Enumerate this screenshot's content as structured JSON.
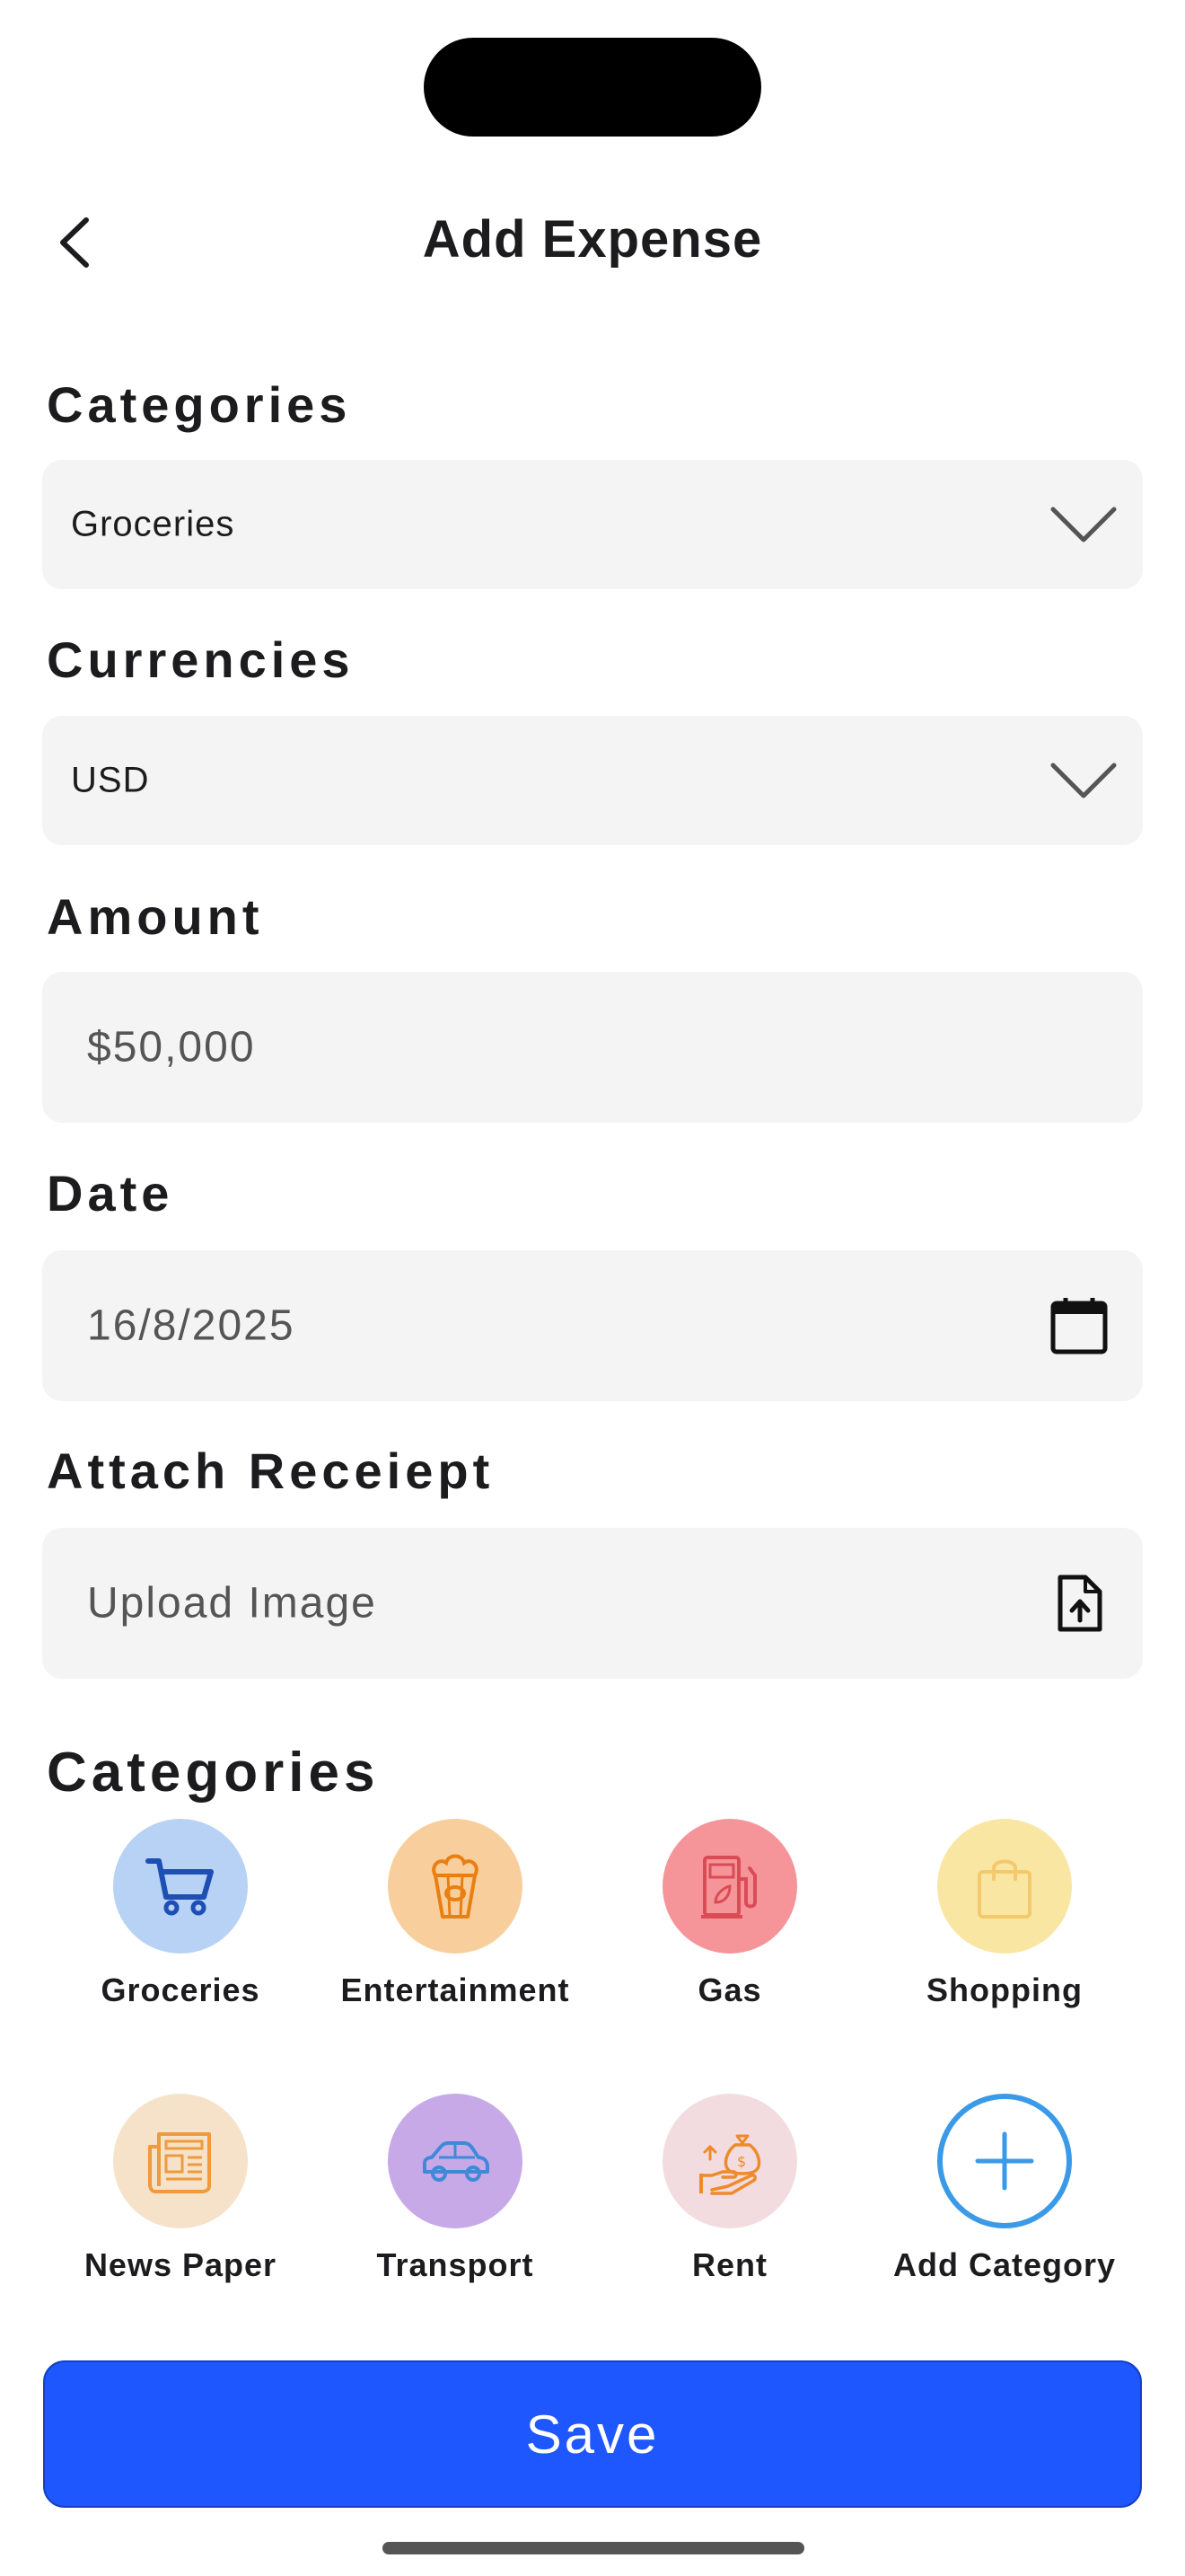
{
  "header": {
    "title": "Add Expense"
  },
  "form": {
    "category_label": "Categories",
    "category_value": "Groceries",
    "currency_label": "Currencies",
    "currency_value": "USD",
    "amount_label": "Amount",
    "amount_value": "$50,000",
    "date_label": "Date",
    "date_value": "16/8/2025",
    "receipt_label": "Attach Receiept",
    "receipt_placeholder": "Upload Image"
  },
  "categories": {
    "title": "Categories",
    "items": [
      {
        "label": "Groceries",
        "icon": "cart-icon",
        "bg": "#b8d2f5",
        "fg": "#1e4fb5"
      },
      {
        "label": "Entertainment",
        "icon": "popcorn-icon",
        "bg": "#f8cf9c",
        "fg": "#e97f12"
      },
      {
        "label": "Gas",
        "icon": "fuel-pump-icon",
        "bg": "#f5959a",
        "fg": "#d94c55"
      },
      {
        "label": "Shopping",
        "icon": "shopping-bag-icon",
        "bg": "#f9e6a3",
        "fg": "#f3c96b"
      },
      {
        "label": "News Paper",
        "icon": "newspaper-icon",
        "bg": "#f5e2c9",
        "fg": "#ef9a3c"
      },
      {
        "label": "Transport",
        "icon": "car-icon",
        "bg": "#c7a9e8",
        "fg": "#3e8ad8"
      },
      {
        "label": "Rent",
        "icon": "money-bag-icon",
        "bg": "#f3dce0",
        "fg": "#ef8a2a"
      },
      {
        "label": "Add Category",
        "icon": "plus-icon",
        "bg": "#ffffff",
        "fg": "#3b9ae8"
      }
    ]
  },
  "actions": {
    "save_label": "Save"
  }
}
